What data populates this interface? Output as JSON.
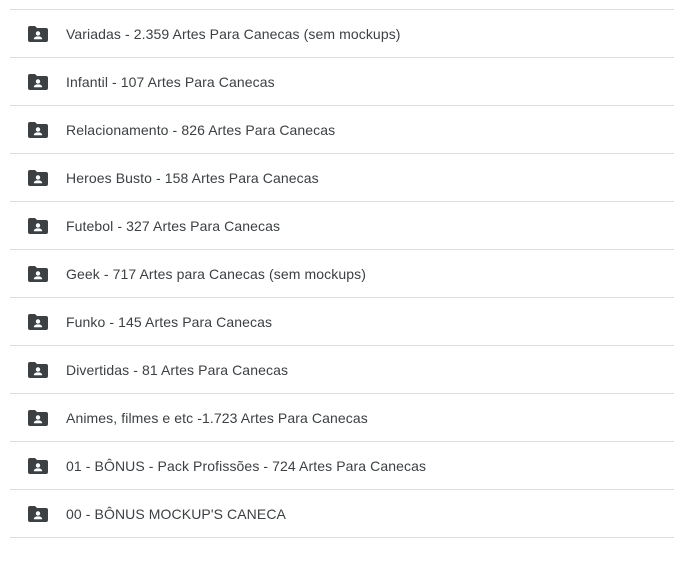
{
  "colors": {
    "icon": "#3c4043",
    "divider": "#dadce0",
    "text": "#3c4043"
  },
  "folders": [
    {
      "name": "Variadas - 2.359 Artes Para Canecas (sem mockups)",
      "icon": "shared-folder-icon"
    },
    {
      "name": "Infantil - 107 Artes Para Canecas",
      "icon": "shared-folder-icon"
    },
    {
      "name": "Relacionamento - 826 Artes Para Canecas",
      "icon": "shared-folder-icon"
    },
    {
      "name": "Heroes Busto - 158 Artes Para Canecas",
      "icon": "shared-folder-icon"
    },
    {
      "name": "Futebol - 327 Artes Para Canecas",
      "icon": "shared-folder-icon"
    },
    {
      "name": "Geek - 717 Artes para Canecas (sem mockups)",
      "icon": "shared-folder-icon"
    },
    {
      "name": "Funko - 145 Artes Para Canecas",
      "icon": "shared-folder-icon"
    },
    {
      "name": "Divertidas - 81 Artes Para Canecas",
      "icon": "shared-folder-icon"
    },
    {
      "name": "Animes, filmes e etc -1.723 Artes Para Canecas",
      "icon": "shared-folder-icon"
    },
    {
      "name": "01 - BÔNUS - Pack Profissões - 724 Artes Para Canecas",
      "icon": "shared-folder-icon"
    },
    {
      "name": "00 - BÔNUS MOCKUP'S CANECA",
      "icon": "shared-folder-icon"
    }
  ]
}
